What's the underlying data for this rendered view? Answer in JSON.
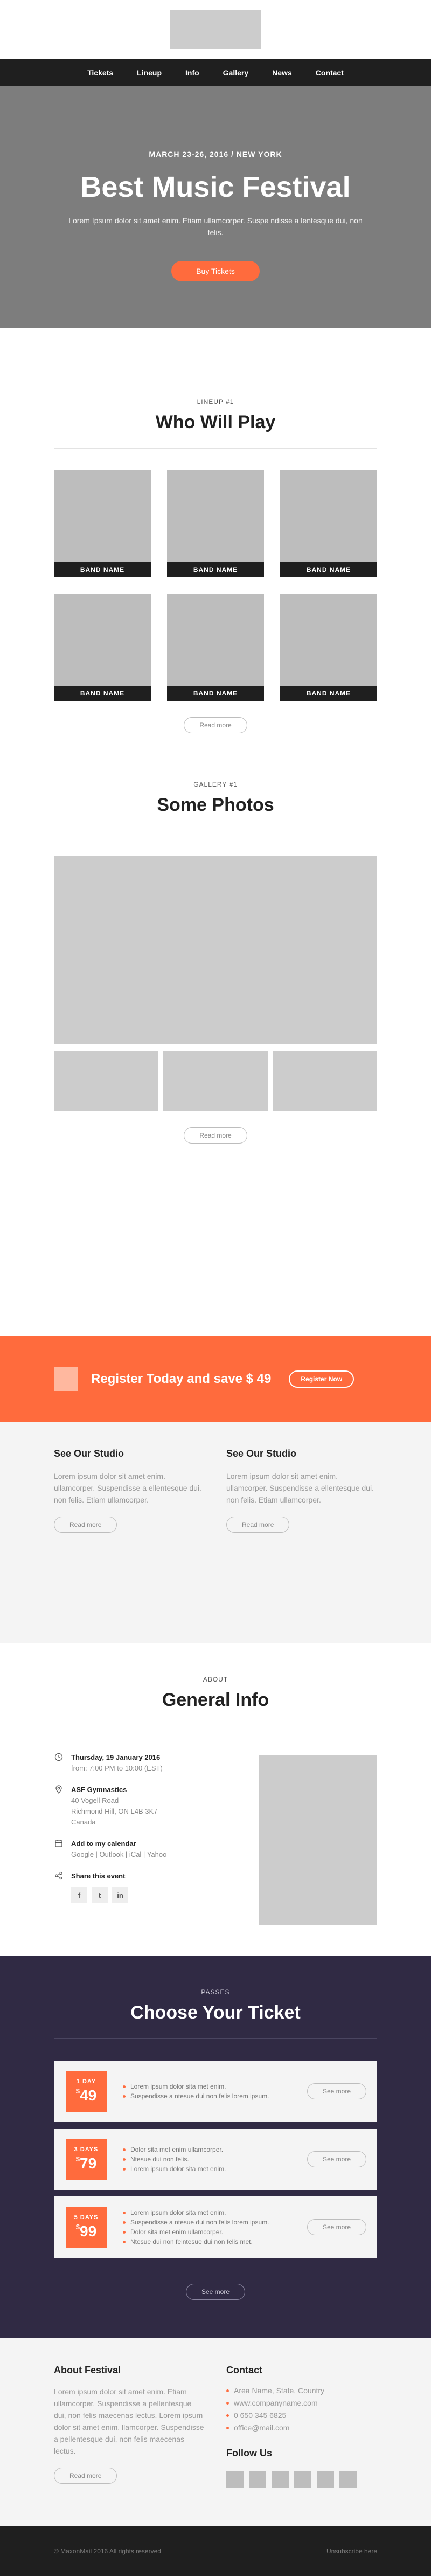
{
  "nav": [
    "Tickets",
    "Lineup",
    "Info",
    "Gallery",
    "News",
    "Contact"
  ],
  "hero": {
    "date": "MARCH 23-26, 2016 / NEW YORK",
    "title": "Best Music Festival",
    "desc": "Lorem Ipsum dolor sit amet enim. Etiam ullamcorper. Suspe ndisse a lentesque dui, non felis.",
    "button": "Buy Tickets"
  },
  "lineup": {
    "eyebrow": "LINEUP #1",
    "title": "Who Will Play",
    "bands": [
      "BAND NAME",
      "BAND NAME",
      "BAND NAME",
      "BAND NAME",
      "BAND NAME",
      "BAND NAME"
    ],
    "button": "Read more"
  },
  "gallery": {
    "eyebrow": "GALLERY #1",
    "title": "Some Photos",
    "button": "Read more"
  },
  "register": {
    "text": "Register Today and save $ 49",
    "button": "Register Now"
  },
  "studio": [
    {
      "title": "See Our Studio",
      "text": "Lorem ipsum dolor sit amet enim. ullamcorper. Suspendisse a ellentesque dui. non felis. Etiam ullamcorper.",
      "button": "Read more"
    },
    {
      "title": "See Our Studio",
      "text": "Lorem ipsum dolor sit amet enim. ullamcorper. Suspendisse a ellentesque dui. non felis. Etiam ullamcorper.",
      "button": "Read more"
    }
  ],
  "about": {
    "eyebrow": "ABOUT",
    "title": "General Info",
    "date_strong": "Thursday, 19 January 2016",
    "date_line": "from: 7:00 PM to 10:00 (EST)",
    "venue_strong": "ASF Gymnastics",
    "venue_lines": [
      "40 Vogell Road",
      "Richmond Hill, ON L4B 3K7",
      "Canada"
    ],
    "calendar_strong": "Add to my calendar",
    "calendar_links": "Google | Outlook | iCal | Yahoo",
    "share_strong": "Share this event",
    "social": [
      "f",
      "t",
      "in"
    ]
  },
  "tickets": {
    "eyebrow": "PASSES",
    "title": "Choose Your Ticket",
    "items": [
      {
        "days": "1 DAY",
        "price": "49",
        "features": [
          "Lorem ipsum dolor sita met enim.",
          "Suspendisse a ntesue dui non felis lorem ipsum."
        ],
        "button": "See more"
      },
      {
        "days": "3 DAYS",
        "price": "79",
        "features": [
          "Dolor sita met enim ullamcorper.",
          "Ntesue dui non felis.",
          "Lorem ipsum dolor sita met enim."
        ],
        "button": "See more"
      },
      {
        "days": "5 DAYS",
        "price": "99",
        "features": [
          "Lorem ipsum dolor sita met enim.",
          "Suspendisse a ntesue dui non felis lorem ipsum.",
          "Dolor sita met enim ullamcorper.",
          "Ntesue dui non felntesue dui non felis met."
        ],
        "button": "See more"
      }
    ],
    "button": "See more"
  },
  "footer": {
    "about_title": "About Festival",
    "about_text": "Lorem ipsum dolor sit amet enim. Etiam ullamcorper. Suspendisse a pellentesque dui, non felis maecenas lectus. Lorem ipsum dolor sit amet enim. llamcorper. Suspendisse a pellentesque dui, non felis maecenas lectus.",
    "about_button": "Read more",
    "contact_title": "Contact",
    "contact_items": [
      "Area Name, State, Country",
      "www.companyname.com",
      "0 650 345 6825",
      "office@mail.com"
    ],
    "follow_title": "Follow Us"
  },
  "bottom": {
    "copyright": "© MaxonMail 2016 All rights reserved",
    "unsubscribe": "Unsubscribe here"
  }
}
